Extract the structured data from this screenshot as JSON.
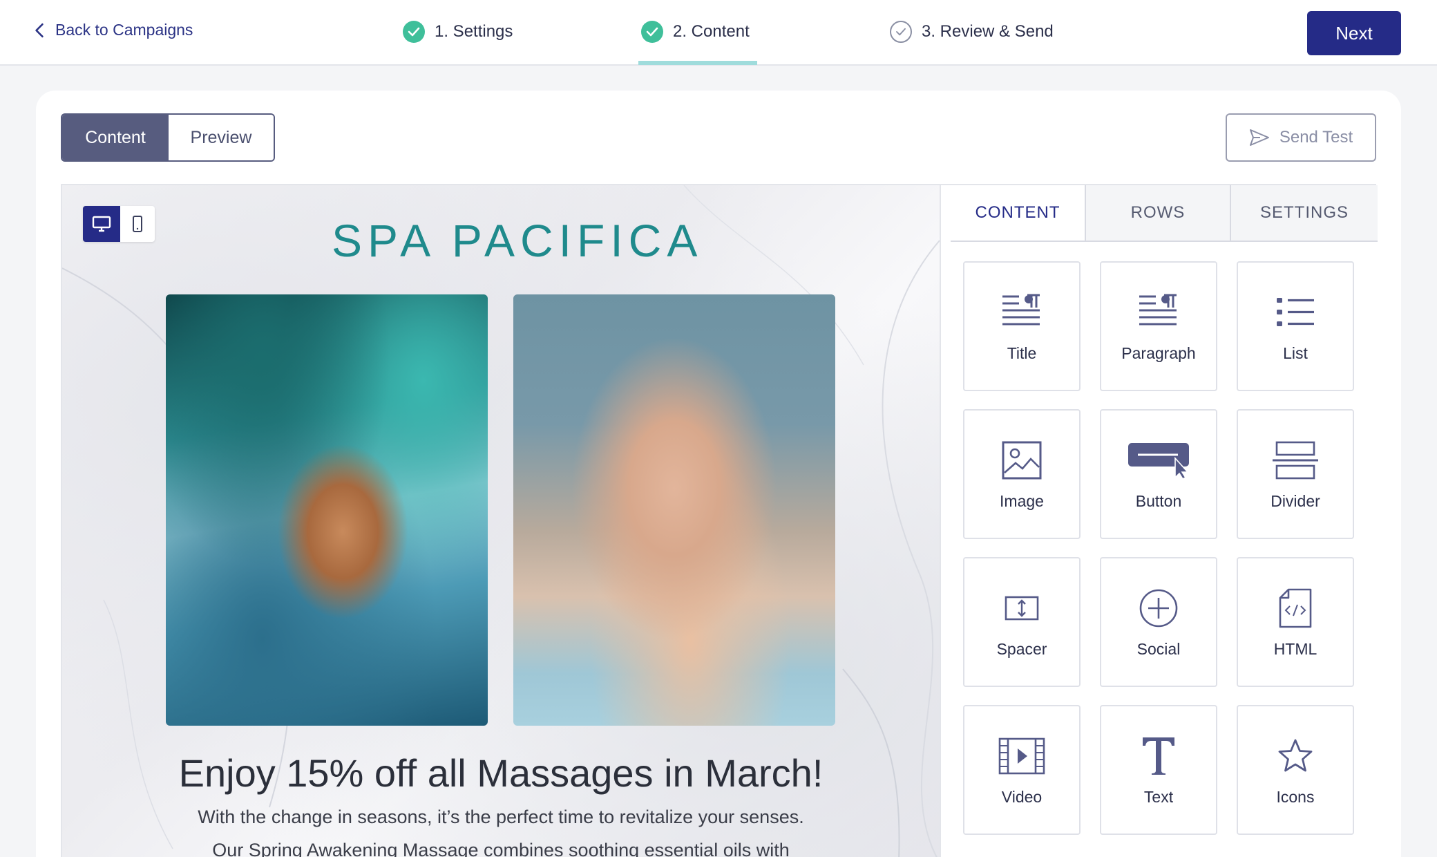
{
  "header": {
    "back_label": "Back to Campaigns",
    "steps": [
      {
        "label": "1. Settings",
        "status": "done"
      },
      {
        "label": "2. Content",
        "status": "done"
      },
      {
        "label": "3. Review & Send",
        "status": "todo"
      }
    ],
    "next_label": "Next"
  },
  "toolbar": {
    "content_toggle": "Content",
    "preview_toggle": "Preview",
    "send_test_label": "Send Test"
  },
  "email": {
    "logo_text": "SPA PACIFICA",
    "headline": "Enjoy 15% off all Massages in March!",
    "body_line1": "With the change in seasons, it’s the perfect time to revitalize your senses.",
    "body_line2": "Our Spring Awakening Massage combines soothing essential oils with"
  },
  "panel": {
    "tabs": [
      "CONTENT",
      "ROWS",
      "SETTINGS"
    ],
    "blocks": [
      {
        "label": "Title",
        "icon": "title-icon"
      },
      {
        "label": "Paragraph",
        "icon": "paragraph-icon"
      },
      {
        "label": "List",
        "icon": "list-icon"
      },
      {
        "label": "Image",
        "icon": "image-icon"
      },
      {
        "label": "Button",
        "icon": "button-icon"
      },
      {
        "label": "Divider",
        "icon": "divider-icon"
      },
      {
        "label": "Spacer",
        "icon": "spacer-icon"
      },
      {
        "label": "Social",
        "icon": "social-icon"
      },
      {
        "label": "HTML",
        "icon": "html-icon"
      },
      {
        "label": "Video",
        "icon": "video-icon"
      },
      {
        "label": "Text",
        "icon": "text-icon"
      },
      {
        "label": "Icons",
        "icon": "star-icon"
      }
    ]
  },
  "colors": {
    "primary": "#252b87",
    "success": "#3fbf9a",
    "brand_teal": "#1f8a8c",
    "icon": "#555a88"
  }
}
